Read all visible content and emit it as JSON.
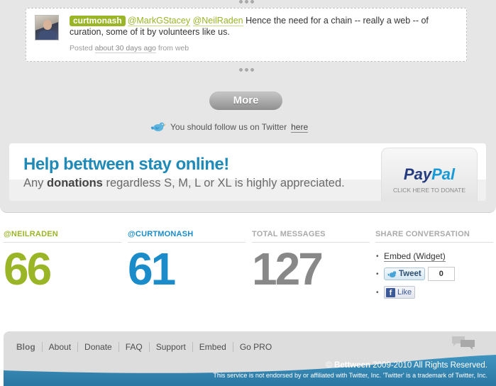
{
  "tweet": {
    "username": "curtmonash",
    "mention_1": "@MarkGStacey",
    "mention_2": "@NeilRaden",
    "text": " Hence the need for a chain -- really a web -- of curation, some of it by volunteers like us.",
    "posted_prefix": "Posted ",
    "posted_time": "about 30 days ago",
    "posted_from": " from web"
  },
  "more_button": "More",
  "follow": {
    "text": "You should follow us on Twitter ",
    "link": "here"
  },
  "donation_banner": {
    "title": "Help bettween stay online!",
    "sub_prefix": "Any ",
    "sub_bold": "donations",
    "sub_suffix": " regardless S, M, L or XL is highly appreciated.",
    "paypal_pay": "Pay",
    "paypal_pal": "Pal",
    "paypal_cta": "CLICK HERE TO DONATE"
  },
  "stats": [
    {
      "label": "@NEILRADEN",
      "value": "66",
      "color": "#9ab526"
    },
    {
      "label": "@CURTMONASH",
      "value": "61",
      "color": "#1a8cc9"
    },
    {
      "label": "TOTAL MESSAGES",
      "value": "127",
      "color": "#888888"
    }
  ],
  "share": {
    "label": "SHARE CONVERSATION",
    "embed": "Embed (Widget)",
    "tweet_label": "Tweet",
    "tweet_count": "0",
    "like_label": "Like"
  },
  "footer": {
    "nav": [
      "Blog",
      "About",
      "Donate",
      "FAQ",
      "Support",
      "Embed",
      "Go PRO"
    ],
    "copyright_symbol": "© ",
    "copyright_brand": "Bettween",
    "copyright_rest": " 2009-2010 All Rights Reserved.",
    "disclaimer": "This service is not endorsed by or affiliated with Twitter, Inc. 'Twitter' is a trademark of Twitter, Inc."
  },
  "colors": {
    "accent_green": "#9ab526",
    "accent_blue": "#1a8cc9",
    "footer_blue": "#2f82ad"
  }
}
